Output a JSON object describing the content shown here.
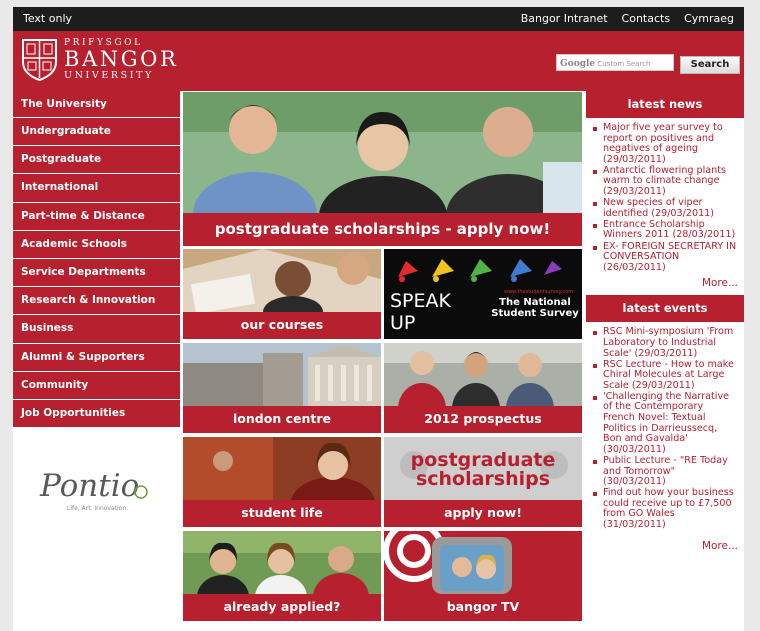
{
  "topbar": {
    "text_only": "Text only",
    "links": [
      "Bangor Intranet",
      "Contacts",
      "Cymraeg"
    ]
  },
  "header": {
    "line1": "PRIFYSGOL",
    "line2": "BANGOR",
    "line3": "UNIVERSITY",
    "search_placeholder": "Custom Search",
    "search_brand": "Google",
    "search_button": "Search"
  },
  "nav": [
    "The University",
    "Undergraduate",
    "Postgraduate",
    "International",
    "Part-time & Distance",
    "Academic Schools",
    "Service Departments",
    "Research & Innovation",
    "Business",
    "Alumni & Supporters",
    "Community",
    "Job Opportunities"
  ],
  "pontio": {
    "name": "Pontio",
    "tagline": "Life. Art. Innovation."
  },
  "hero_caption": "postgraduate scholarships - apply now!",
  "tiles": [
    {
      "caption": "our courses"
    },
    {
      "caption": "",
      "t1": "SPEAK",
      "t2": "UP",
      "t3": "The National Student Survey",
      "t4": "www.thestudentsurvey.com"
    },
    {
      "caption": "london centre"
    },
    {
      "caption": "2012 prospectus"
    },
    {
      "caption": "student life"
    },
    {
      "caption": "apply now!",
      "t1": "postgraduate",
      "t2": "scholarships"
    },
    {
      "caption": "already applied?"
    },
    {
      "caption": "bangor TV"
    }
  ],
  "news": {
    "title": "latest news",
    "items": [
      "Major five year survey to report on positives and negatives of ageing (29/03/2011)",
      "Antarctic flowering plants warm to climate change (29/03/2011)",
      "New species of viper identified (29/03/2011)",
      "Entrance Scholarship Winners 2011 (28/03/2011)",
      "EX- FOREIGN SECRETARY IN CONVERSATION (26/03/2011)"
    ],
    "more": "More..."
  },
  "events": {
    "title": "latest events",
    "items": [
      "RSC Mini-symposium 'From Laboratory to Industrial Scale' (29/03/2011)",
      "RSC Lecture - How to make Chiral Molecules at Large Scale (29/03/2011)",
      "'Challenging the Narrative of the Contemporary French Novel: Textual Politics in Darrieussecq, Bon and Gavalda' (30/03/2011)",
      "Public Lecture - \"RE Today and Tomorrow\" (30/03/2011)",
      "Find out how your business could receive up to £7,500 from GO Wales (31/03/2011)"
    ],
    "more": "More..."
  },
  "colors": {
    "brand_red": "#b6202f",
    "topbar": "#1d1d1d",
    "background": "#e9e9e9"
  }
}
